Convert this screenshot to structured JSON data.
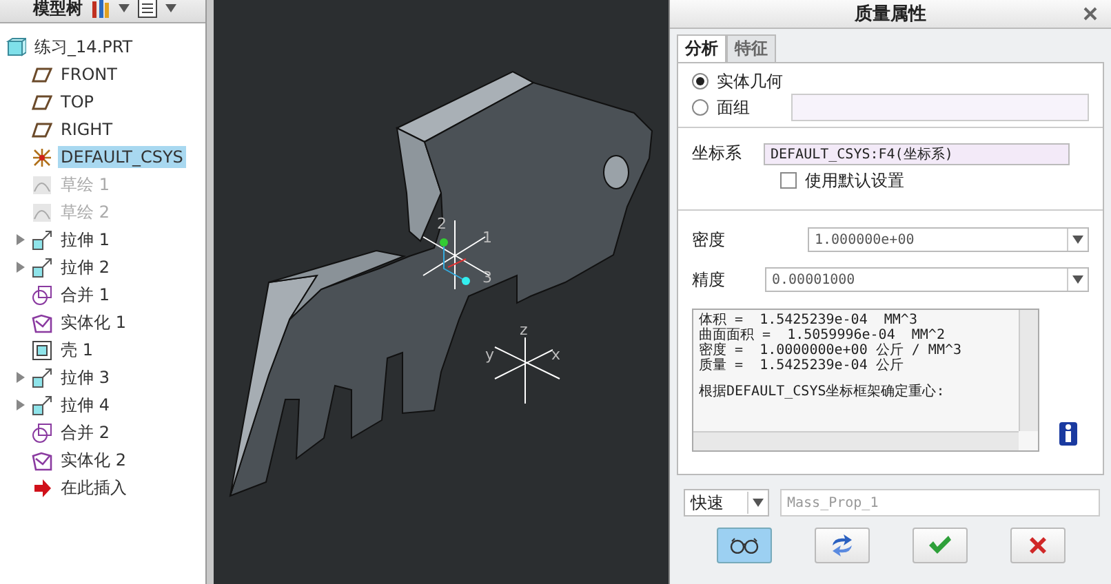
{
  "model_tree": {
    "title": "模型树",
    "items": [
      {
        "label": "练习_14.PRT",
        "kind": "part",
        "expandable": false,
        "disabled": false,
        "selected": false
      },
      {
        "label": "FRONT",
        "kind": "plane",
        "expandable": false,
        "disabled": false,
        "selected": false
      },
      {
        "label": "TOP",
        "kind": "plane",
        "expandable": false,
        "disabled": false,
        "selected": false
      },
      {
        "label": "RIGHT",
        "kind": "plane",
        "expandable": false,
        "disabled": false,
        "selected": false
      },
      {
        "label": "DEFAULT_CSYS",
        "kind": "csys",
        "expandable": false,
        "disabled": false,
        "selected": true
      },
      {
        "label": "草绘 1",
        "kind": "sketch",
        "expandable": false,
        "disabled": true,
        "selected": false
      },
      {
        "label": "草绘 2",
        "kind": "sketch",
        "expandable": false,
        "disabled": true,
        "selected": false
      },
      {
        "label": "拉伸 1",
        "kind": "extrude",
        "expandable": true,
        "disabled": false,
        "selected": false
      },
      {
        "label": "拉伸 2",
        "kind": "extrude",
        "expandable": true,
        "disabled": false,
        "selected": false
      },
      {
        "label": "合并 1",
        "kind": "merge",
        "expandable": false,
        "disabled": false,
        "selected": false
      },
      {
        "label": "实体化 1",
        "kind": "solidify",
        "expandable": false,
        "disabled": false,
        "selected": false
      },
      {
        "label": "壳 1",
        "kind": "shell",
        "expandable": false,
        "disabled": false,
        "selected": false
      },
      {
        "label": "拉伸 3",
        "kind": "extrude",
        "expandable": true,
        "disabled": false,
        "selected": false
      },
      {
        "label": "拉伸 4",
        "kind": "extrude",
        "expandable": true,
        "disabled": false,
        "selected": false
      },
      {
        "label": "合并 2",
        "kind": "merge",
        "expandable": false,
        "disabled": false,
        "selected": false
      },
      {
        "label": "实体化 2",
        "kind": "solidify",
        "expandable": false,
        "disabled": false,
        "selected": false
      },
      {
        "label": "在此插入",
        "kind": "insert",
        "expandable": false,
        "disabled": false,
        "selected": false
      }
    ]
  },
  "viewport": {
    "part_csys_labels": [
      "2",
      "1",
      "3"
    ],
    "default_csys_labels": [
      "z",
      "y",
      "x"
    ]
  },
  "dialog": {
    "title": "质量属性",
    "tabs": [
      {
        "label": "分析",
        "selected": true
      },
      {
        "label": "特征",
        "selected": false
      }
    ],
    "radios": [
      {
        "label": "实体几何",
        "selected": true
      },
      {
        "label": "面组",
        "selected": false
      }
    ],
    "csys_label": "坐标系",
    "csys_value": "DEFAULT_CSYS:F4(坐标系)",
    "default_checkbox": {
      "label": "使用默认设置",
      "checked": false
    },
    "density": {
      "label": "密度",
      "value": "1.000000e+00"
    },
    "precision": {
      "label": "精度",
      "value": "0.00001000"
    },
    "results": [
      "体积 =  1.5425239e-04  MM^3",
      "曲面面积 =  1.5059996e-04  MM^2",
      "密度 =  1.0000000e+00 公斤 / MM^3",
      "质量 =  1.5425239e-04 公斤"
    ],
    "results_note": "根据DEFAULT_CSYS坐标框架确定重心:",
    "mode": {
      "value": "快速"
    },
    "name_field": {
      "placeholder": "Mass_Prop_1"
    },
    "buttons": [
      {
        "kind": "preview",
        "selected": true
      },
      {
        "kind": "repeat",
        "selected": false
      },
      {
        "kind": "ok",
        "selected": false
      },
      {
        "kind": "cancel",
        "selected": false
      }
    ]
  }
}
